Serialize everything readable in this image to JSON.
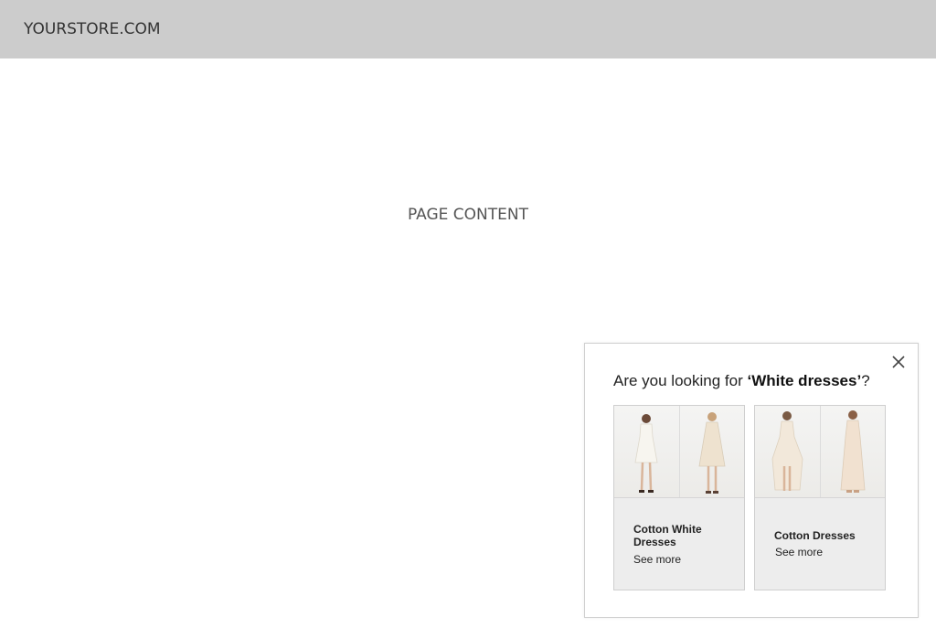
{
  "header": {
    "logo_text": "YOURSTORE.COM"
  },
  "main": {
    "placeholder_text": "PAGE CONTENT"
  },
  "popup": {
    "question_prefix": "Are you looking for ",
    "question_term": "‘White dresses’",
    "question_suffix": "?",
    "close_icon": "close-icon",
    "cards": [
      {
        "title": "Cotton White Dresses",
        "link_label": "See more",
        "image_colors": [
          "#f3f0e9",
          "#efe6d6"
        ]
      },
      {
        "title": "Cotton Dresses",
        "link_label": "See more",
        "image_colors": [
          "#f1e6d8",
          "#f0e2d3"
        ]
      }
    ]
  }
}
